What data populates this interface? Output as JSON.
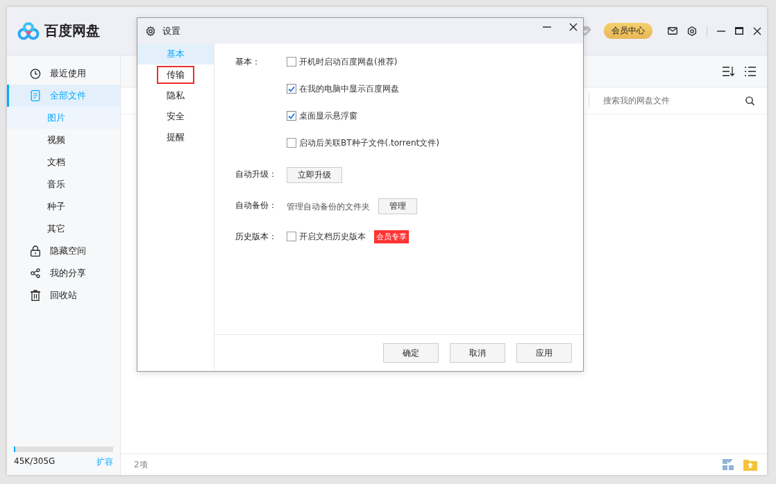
{
  "app": {
    "logo_text": "百度网盘",
    "vip_button": "会员中心"
  },
  "sidebar": {
    "items": [
      {
        "label": "最近使用",
        "kind": "clock",
        "selected": false
      },
      {
        "label": "全部文件",
        "kind": "file",
        "selected": true,
        "children": [
          {
            "label": "图片",
            "selected": true
          },
          {
            "label": "视频",
            "selected": false
          },
          {
            "label": "文档",
            "selected": false
          },
          {
            "label": "音乐",
            "selected": false
          },
          {
            "label": "种子",
            "selected": false
          },
          {
            "label": "其它",
            "selected": false
          }
        ]
      },
      {
        "label": "隐藏空间",
        "kind": "lock",
        "selected": false
      },
      {
        "label": "我的分享",
        "kind": "share",
        "selected": false
      },
      {
        "label": "回收站",
        "kind": "trash",
        "selected": false
      }
    ]
  },
  "storage": {
    "text": "45K/305G",
    "level": 0.01,
    "link": "扩容"
  },
  "search": {
    "placeholder": "搜索我的网盘文件"
  },
  "status_bar": {
    "count": "2项"
  },
  "dialog": {
    "title": "设置",
    "nav": [
      {
        "label": "基本",
        "selected": true,
        "highlighted": false
      },
      {
        "label": "传输",
        "selected": false,
        "highlighted": true
      },
      {
        "label": "隐私",
        "selected": false,
        "highlighted": false
      },
      {
        "label": "安全",
        "selected": false,
        "highlighted": false
      },
      {
        "label": "提醒",
        "selected": false,
        "highlighted": false
      }
    ],
    "sections": [
      {
        "kind": "checks",
        "label": "基本：",
        "options": [
          {
            "label": "开机时启动百度网盘(推荐)",
            "checked": false
          },
          {
            "label": "在我的电脑中显示百度网盘",
            "checked": true
          },
          {
            "label": "桌面显示悬浮窗",
            "checked": true
          },
          {
            "label": "启动后关联BT种子文件(.torrent文件)",
            "checked": false
          }
        ]
      },
      {
        "kind": "button",
        "label": "自动升级：",
        "button": "立即升级"
      },
      {
        "kind": "text_button",
        "label": "自动备份：",
        "text": "管理自动备份的文件夹",
        "button": "管理"
      },
      {
        "kind": "check_badge",
        "label": "历史版本：",
        "option": {
          "label": "开启文档历史版本",
          "checked": false
        },
        "badge": "会员专享"
      }
    ],
    "buttons": [
      "确定",
      "取消",
      "应用"
    ]
  }
}
